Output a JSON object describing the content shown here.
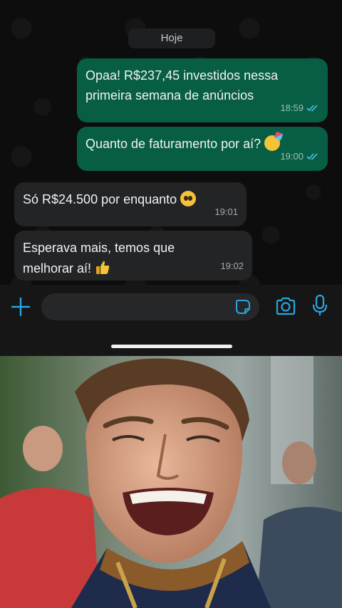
{
  "chat": {
    "date_label": "Hoje",
    "messages": [
      {
        "direction": "out",
        "text_line1": "Opaa! R$237,45 investidos nessa",
        "text_line2": "primeira semana de anúncios",
        "time": "18:59",
        "status": "read"
      },
      {
        "direction": "out",
        "text_line1": "Quanto de faturamento por aí?",
        "emoji": "party-face-emoji",
        "time": "19:00",
        "status": "read"
      },
      {
        "direction": "in",
        "text_line1": "Só R$24.500 por enquanto",
        "emoji": "pleading-face-emoji",
        "time": "19:01"
      },
      {
        "direction": "in",
        "text_line1": "Esperava mais, temos que",
        "text_line2": "melhorar aí!",
        "emoji": "thumbs-up-emoji",
        "time": "19:02"
      }
    ]
  },
  "input_bar": {
    "icons": [
      "plus-icon",
      "sticker-icon",
      "camera-icon",
      "microphone-icon"
    ],
    "accent": "#2aa5e0"
  },
  "colors": {
    "outgoing_bubble": "#075e45",
    "incoming_bubble": "#232426",
    "read_check": "#53bdeb"
  },
  "meme": {
    "description_icon": "smiling-man-photo"
  }
}
